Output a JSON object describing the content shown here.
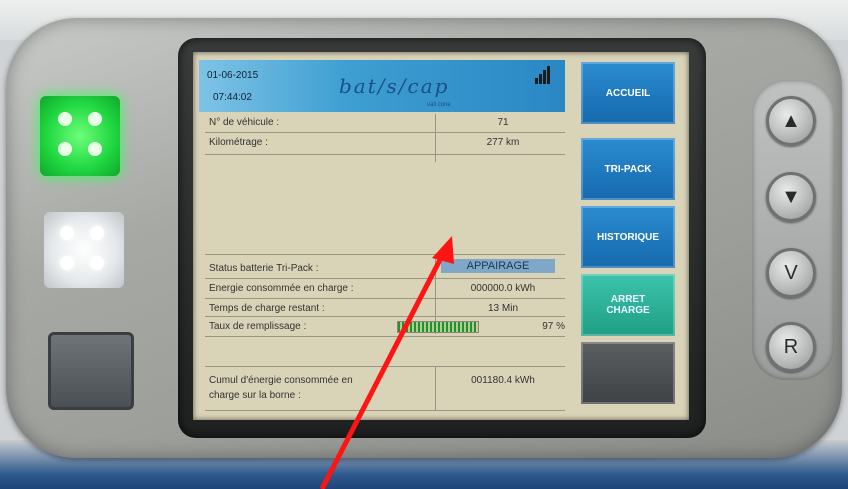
{
  "header": {
    "date": "01-06-2015",
    "time": "07:44:02",
    "logo": "bat/s/cap",
    "logo_sub": "vall cone"
  },
  "rows": {
    "vehicle_label": "N° de véhicule :",
    "vehicle_value": "71",
    "km_label": "Kilométrage :",
    "km_value": "277 km",
    "status_label": "Status batterie Tri-Pack :",
    "status_value": "APPAIRAGE",
    "energy_label": "Energie consommée en charge :",
    "energy_value": "000000.0 kWh",
    "time_label": "Temps de charge restant :",
    "time_value": "13 Min",
    "fill_label": "Taux de remplissage :",
    "fill_value": "97 %",
    "fill_percent": 97,
    "cumul_label_1": "Cumul d'énergie consommée en",
    "cumul_label_2": "charge sur la borne :",
    "cumul_value": "001180.4 kWh"
  },
  "side_buttons": {
    "accueil": "ACCUEIL",
    "tripack": "TRI-PACK",
    "historique": "HISTORIQUE",
    "arret_1": "ARRET",
    "arret_2": "CHARGE"
  },
  "hw_buttons": {
    "up": "▲",
    "down": "▼",
    "v": "V",
    "r": "R"
  },
  "colors": {
    "led_green": "#27e04a",
    "led_white": "#f2f4f4",
    "accent_blue": "#1d7fc2",
    "stop_green": "#27b39a",
    "arrow_red": "#ff1414"
  }
}
